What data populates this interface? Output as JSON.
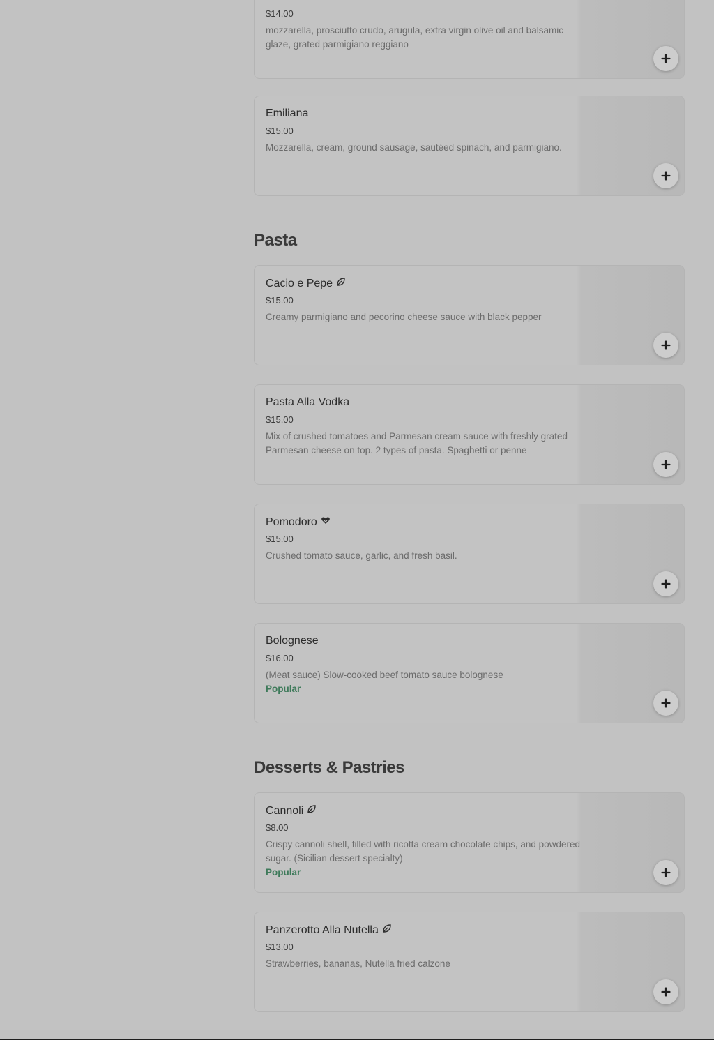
{
  "theme": {
    "page_bg": "#c2c2c2",
    "popular_color": "#3e7a5a"
  },
  "sections": [
    {
      "title": "",
      "items": [
        {
          "name": "",
          "price": "$14.00",
          "description": "mozzarella, prosciutto crudo, arugula, extra virgin olive oil and balsamic glaze, grated parmigiano reggiano",
          "badge": "",
          "icon": "",
          "add_label": "+"
        },
        {
          "name": "Emiliana",
          "price": "$15.00",
          "description": "Mozzarella, cream, ground sausage, sautéed spinach, and parmigiano.",
          "badge": "",
          "icon": "",
          "add_label": "+"
        }
      ]
    },
    {
      "title": "Pasta",
      "items": [
        {
          "name": "Cacio e Pepe",
          "price": "$15.00",
          "description": "Creamy parmigiano and pecorino cheese sauce with black pepper",
          "badge": "",
          "icon": "leaf-icon",
          "add_label": "+"
        },
        {
          "name": "Pasta Alla Vodka",
          "price": "$15.00",
          "description": "Mix of crushed tomatoes and Parmesan cream sauce with freshly grated Parmesan cheese on top. 2 types of pasta. Spaghetti or penne",
          "badge": "",
          "icon": "",
          "add_label": "+"
        },
        {
          "name": "Pomodoro",
          "price": "$15.00",
          "description": "Crushed tomato sauce, garlic, and fresh basil.",
          "badge": "",
          "icon": "heart-icon",
          "add_label": "+"
        },
        {
          "name": "Bolognese",
          "price": "$16.00",
          "description": "(Meat sauce) Slow-cooked beef tomato sauce bolognese",
          "badge": "Popular",
          "icon": "",
          "add_label": "+"
        }
      ]
    },
    {
      "title": "Desserts & Pastries",
      "items": [
        {
          "name": "Cannoli",
          "price": "$8.00",
          "description": "Crispy cannoli shell, filled with ricotta cream chocolate chips, and powdered sugar. (Sicilian dessert specialty)",
          "badge": "Popular",
          "icon": "leaf-icon",
          "add_label": "+"
        },
        {
          "name": "Panzerotto Alla Nutella",
          "price": "$13.00",
          "description": "Strawberries, bananas, Nutella fried calzone",
          "badge": "",
          "icon": "leaf-icon",
          "add_label": "+"
        }
      ]
    }
  ]
}
